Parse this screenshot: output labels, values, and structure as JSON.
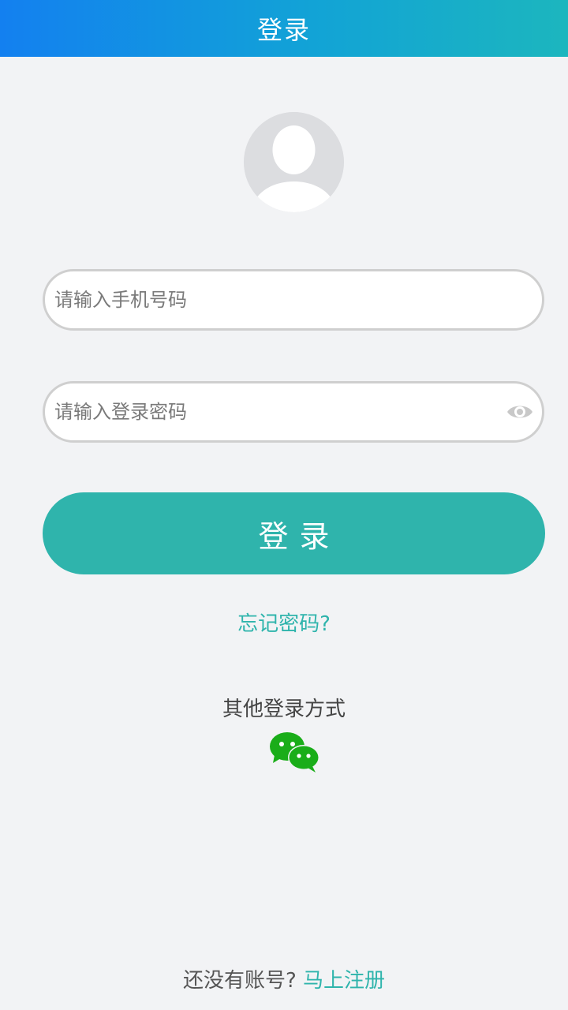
{
  "header": {
    "title": "登录"
  },
  "form": {
    "phone_placeholder": "请输入手机号码",
    "password_placeholder": "请输入登录密码",
    "login_label": "登录"
  },
  "links": {
    "forgot_password": "忘记密码?"
  },
  "other_login": {
    "title": "其他登录方式",
    "icon": "wechat-icon"
  },
  "footer": {
    "prompt": "还没有账号?",
    "register": "马上注册"
  },
  "colors": {
    "header_gradient_start": "#1380f0",
    "header_gradient_end": "#1cb6be",
    "accent": "#2fb4ac",
    "wechat_green": "#1aad19",
    "background": "#f2f3f5"
  }
}
